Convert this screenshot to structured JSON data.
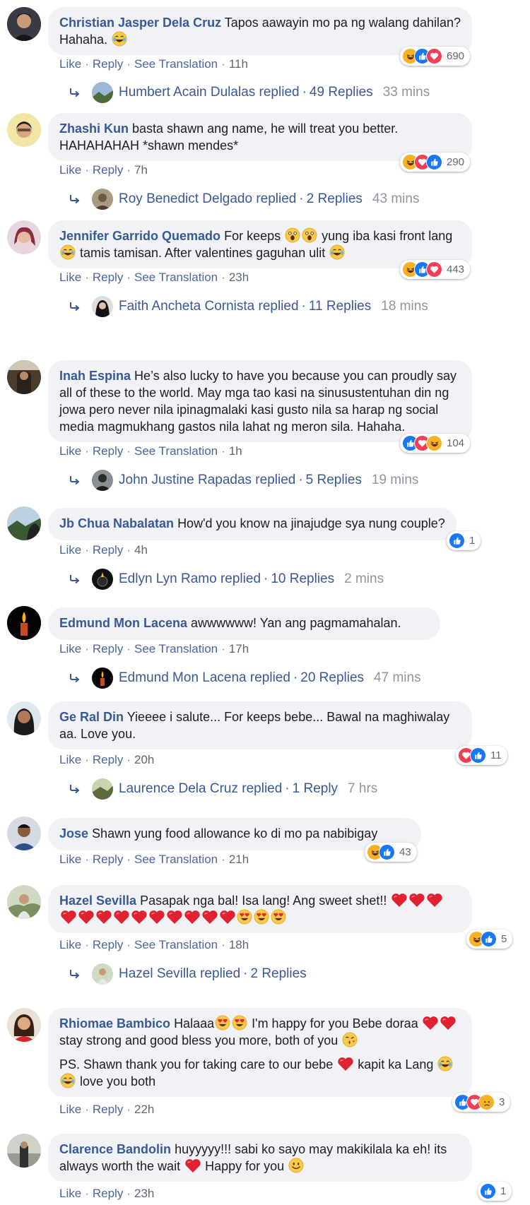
{
  "labels": {
    "like": "Like",
    "reply": "Reply",
    "see_translation": "See Translation",
    "dot": "·"
  },
  "comments": [
    {
      "author": "Christian Jasper Dela Cruz",
      "text": "Tapos aawayin mo pa ng walang dahilan? Hahaha.",
      "time": "11h",
      "reactions": {
        "icons": [
          "haha-icon",
          "like-icon",
          "love-icon"
        ],
        "count": "690"
      },
      "replies": {
        "author": "Humbert Acain Dulalas replied",
        "count": "49 Replies",
        "ago": "33 mins"
      }
    },
    {
      "author": "Zhashi Kun",
      "text": "basta shawn ang name, he will treat you better. HAHAHAHAH *shawn mendes*",
      "time": "7h",
      "reactions": {
        "icons": [
          "haha-icon",
          "love-icon",
          "like-icon"
        ],
        "count": "290"
      },
      "replies": {
        "author": "Roy Benedict Delgado replied",
        "count": "2 Replies",
        "ago": "43 mins"
      }
    },
    {
      "author": "Jennifer Garrido Quemado",
      "text_a": "For keeps",
      "text_b": "yung iba kasi front lang",
      "text_c": "tamis tamisan. After valentines gaguhan ulit",
      "time": "23h",
      "reactions": {
        "icons": [
          "haha-icon",
          "like-icon",
          "love-icon"
        ],
        "count": "443"
      },
      "replies": {
        "author": "Faith Ancheta Cornista replied",
        "count": "11 Replies",
        "ago": "18 mins"
      }
    },
    {
      "author": "Inah Espina",
      "text": "He’s also lucky to have you because you can proudly say all of these to the world. May mga tao kasi na sinusustentuhan din ng jowa pero never nila ipinagmalaki kasi gusto nila sa harap ng social media magmukhang gastos nila lahat ng meron sila. Hahaha.",
      "time": "1h",
      "reactions": {
        "icons": [
          "like-icon",
          "love-icon",
          "haha-icon"
        ],
        "count": "104"
      },
      "replies": {
        "author": "John Justine Rapadas replied",
        "count": "5 Replies",
        "ago": "19 mins"
      }
    },
    {
      "author": "Jb Chua Nabalatan",
      "text": "How'd you know na jinajudge sya nung couple?",
      "time": "4h",
      "reactions": {
        "icons": [
          "like-icon"
        ],
        "count": "1"
      },
      "replies": {
        "author": "Edlyn Lyn Ramo replied",
        "count": "10 Replies",
        "ago": "2 mins"
      }
    },
    {
      "author": "Edmund Mon Lacena",
      "text": "awwwwww! Yan ang pagmamahalan.",
      "time": "17h",
      "reactions": null,
      "replies": {
        "author": "Edmund Mon Lacena replied",
        "count": "20 Replies",
        "ago": "47 mins"
      }
    },
    {
      "author": "Ge Ral Din",
      "text": "Yieeee i salute... For keeps bebe... Bawal na maghiwalay aa. Love you.",
      "time": "20h",
      "reactions": {
        "icons": [
          "love-icon",
          "like-icon"
        ],
        "count": "11"
      },
      "replies": {
        "author": "Laurence Dela Cruz replied",
        "count": "1 Reply",
        "ago": "7 hrs"
      }
    },
    {
      "author": "Jose",
      "text": "Shawn yung food allowance ko di mo pa nabibigay",
      "time": "21h",
      "reactions": {
        "icons": [
          "haha-icon",
          "like-icon"
        ],
        "count": "43"
      },
      "replies": null
    },
    {
      "author": "Hazel Sevilla",
      "text": "Pasapak nga bal! Isa lang! Ang sweet shet!!",
      "time": "18h",
      "reactions": {
        "icons": [
          "haha-icon",
          "like-icon"
        ],
        "count": "5"
      },
      "replies": {
        "author": "Hazel Sevilla replied",
        "count": "2 Replies",
        "ago": ""
      }
    },
    {
      "author": "Rhiomae Bambico",
      "text_a": "Halaaa",
      "text_b": "I'm happy for you Bebe doraa",
      "text_c": "stay strong and good bless you more, both of you",
      "text_d": "PS. Shawn thank you for taking care to our bebe",
      "text_e": "kapit ka Lang",
      "text_f": "love you both",
      "time": "22h",
      "reactions": {
        "icons": [
          "like-icon",
          "love-icon",
          "sad-icon"
        ],
        "count": "3"
      },
      "replies": null
    },
    {
      "author": "Clarence Bandolin",
      "text_a": "huyyyyy!!! sabi ko sayo may makikilala ka eh! its always worth the wait",
      "text_b": "Happy for you",
      "time": "23h",
      "reactions": {
        "icons": [
          "like-icon"
        ],
        "count": "1"
      },
      "replies": null
    }
  ]
}
